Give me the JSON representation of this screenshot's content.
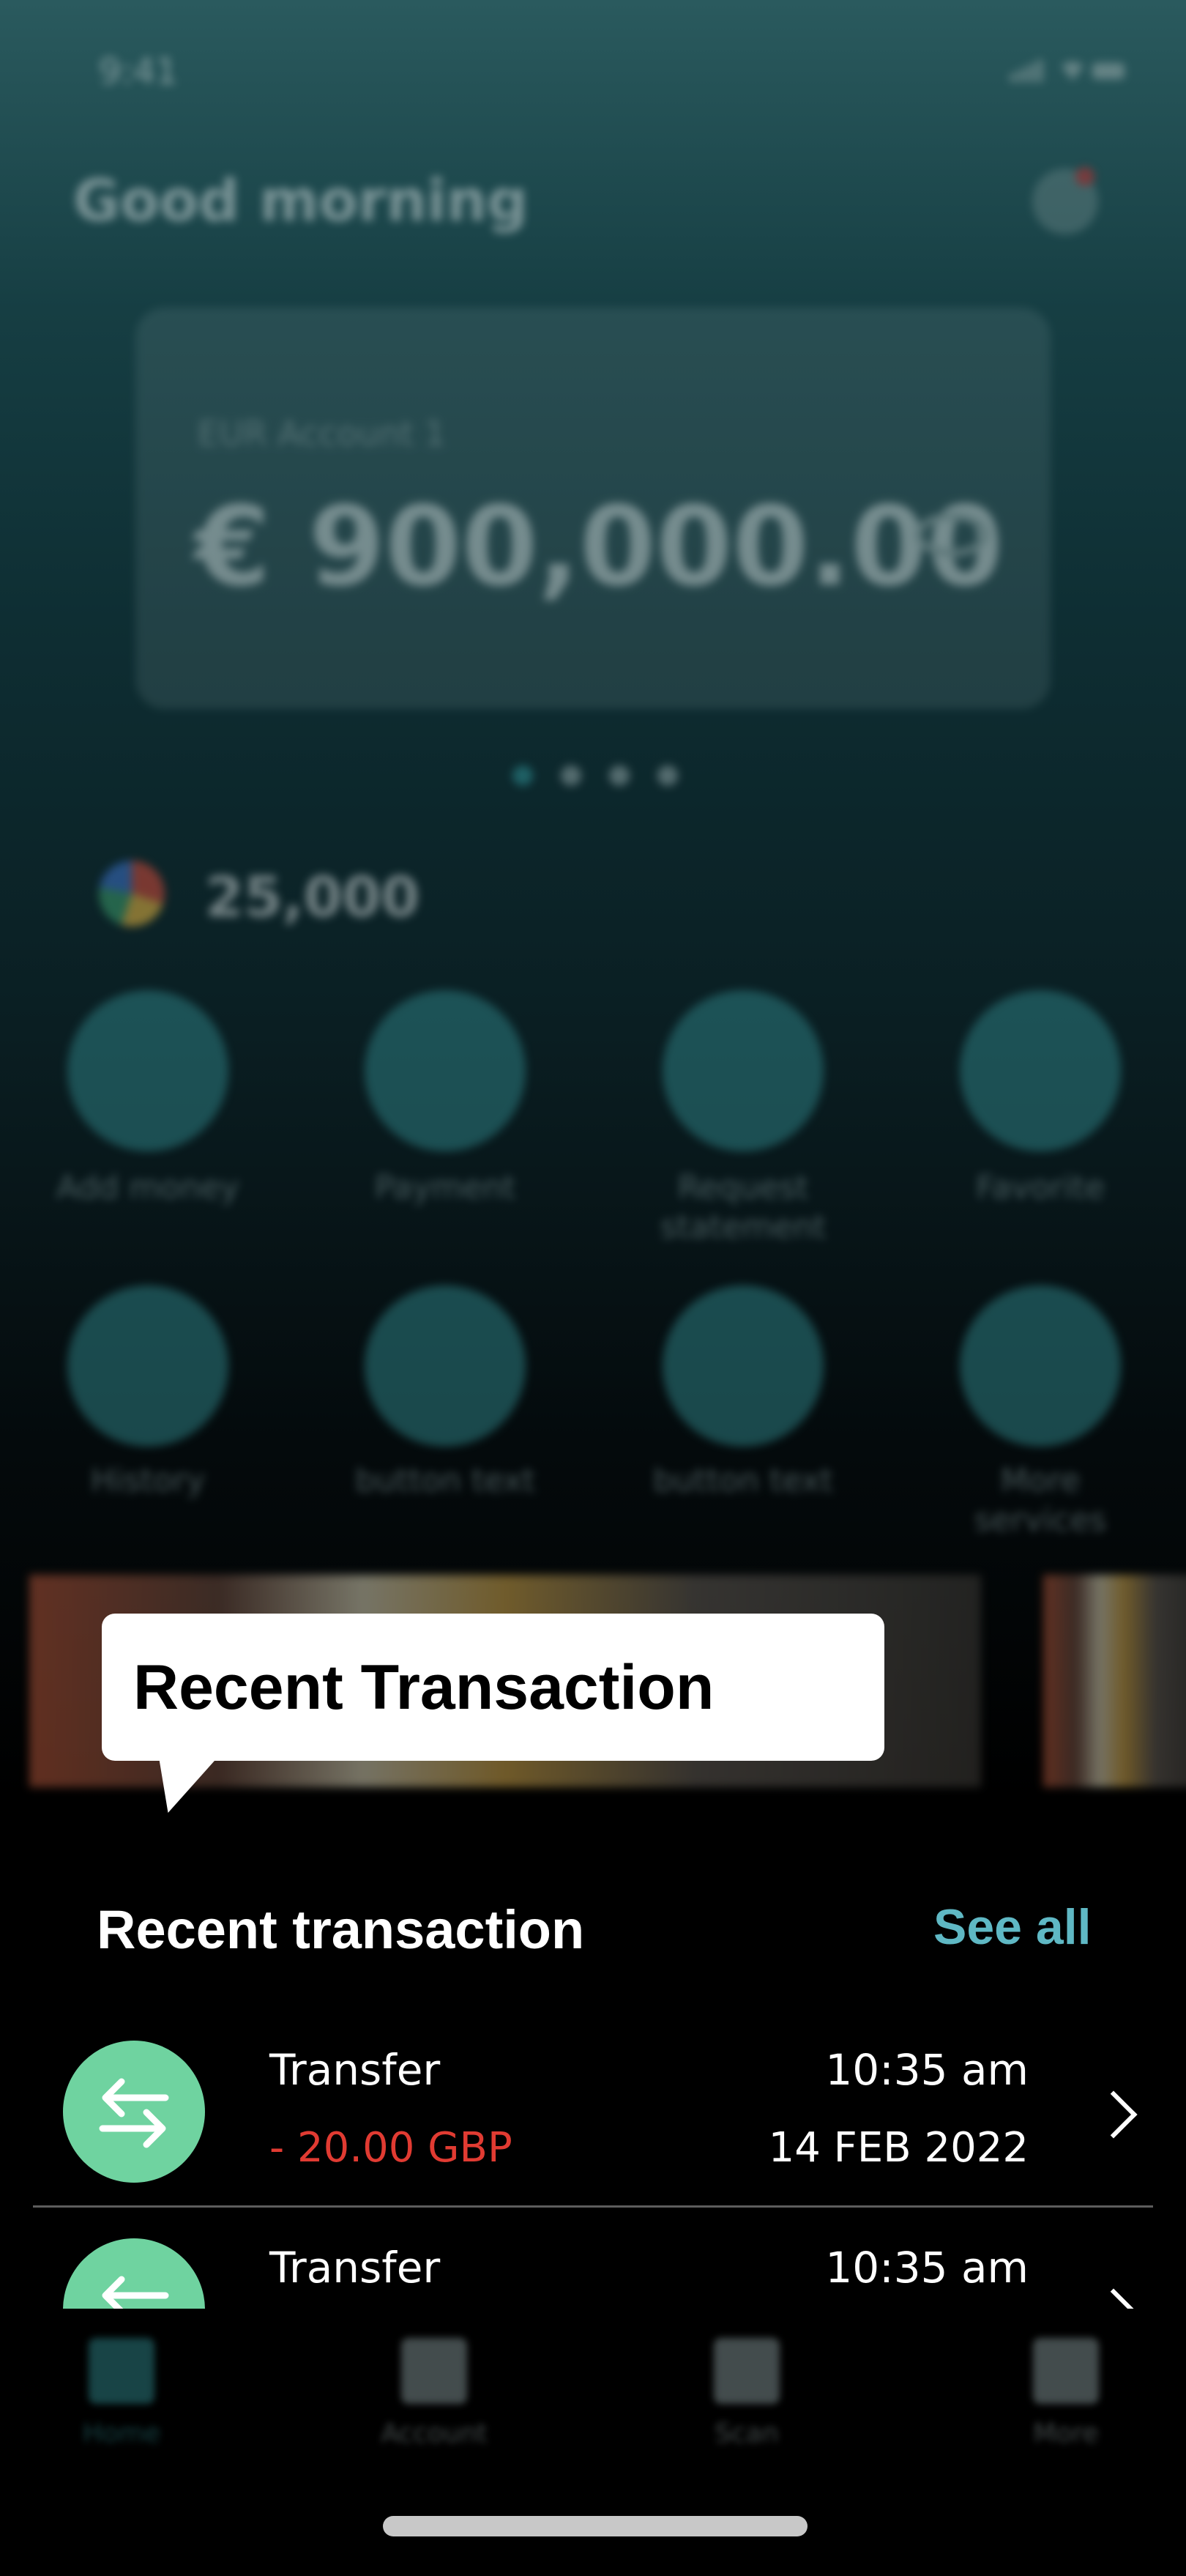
{
  "status_bar": {
    "time": "9:41"
  },
  "header": {
    "greeting": "Good morning"
  },
  "account_card": {
    "label": "EUR Account 1",
    "balance": "€ 900,000.00"
  },
  "points": {
    "value": "25,000"
  },
  "quick_actions": [
    {
      "label": "Add money"
    },
    {
      "label": "Payment"
    },
    {
      "label": "Request statement"
    },
    {
      "label": "Favorite"
    },
    {
      "label": "History"
    },
    {
      "label": "button text"
    },
    {
      "label": "button text"
    },
    {
      "label": "More services"
    }
  ],
  "tooltip": {
    "text": "Recent Transaction"
  },
  "recent": {
    "title": "Recent transaction",
    "see_all": "See all",
    "transactions": [
      {
        "type": "Transfer",
        "amount": "- 20.00 GBP",
        "time": "10:35 am",
        "date": "14 FEB 2022"
      },
      {
        "type": "Transfer",
        "time": "10:35 am"
      }
    ]
  },
  "bottom_nav": [
    {
      "label": "Home",
      "active": true
    },
    {
      "label": "Account"
    },
    {
      "label": "Scan"
    },
    {
      "label": "More"
    }
  ],
  "colors": {
    "accent": "#5fb8c4",
    "negative": "#e13b32",
    "tx_icon": "#6fd3a0",
    "brand": "#2c7c80"
  }
}
